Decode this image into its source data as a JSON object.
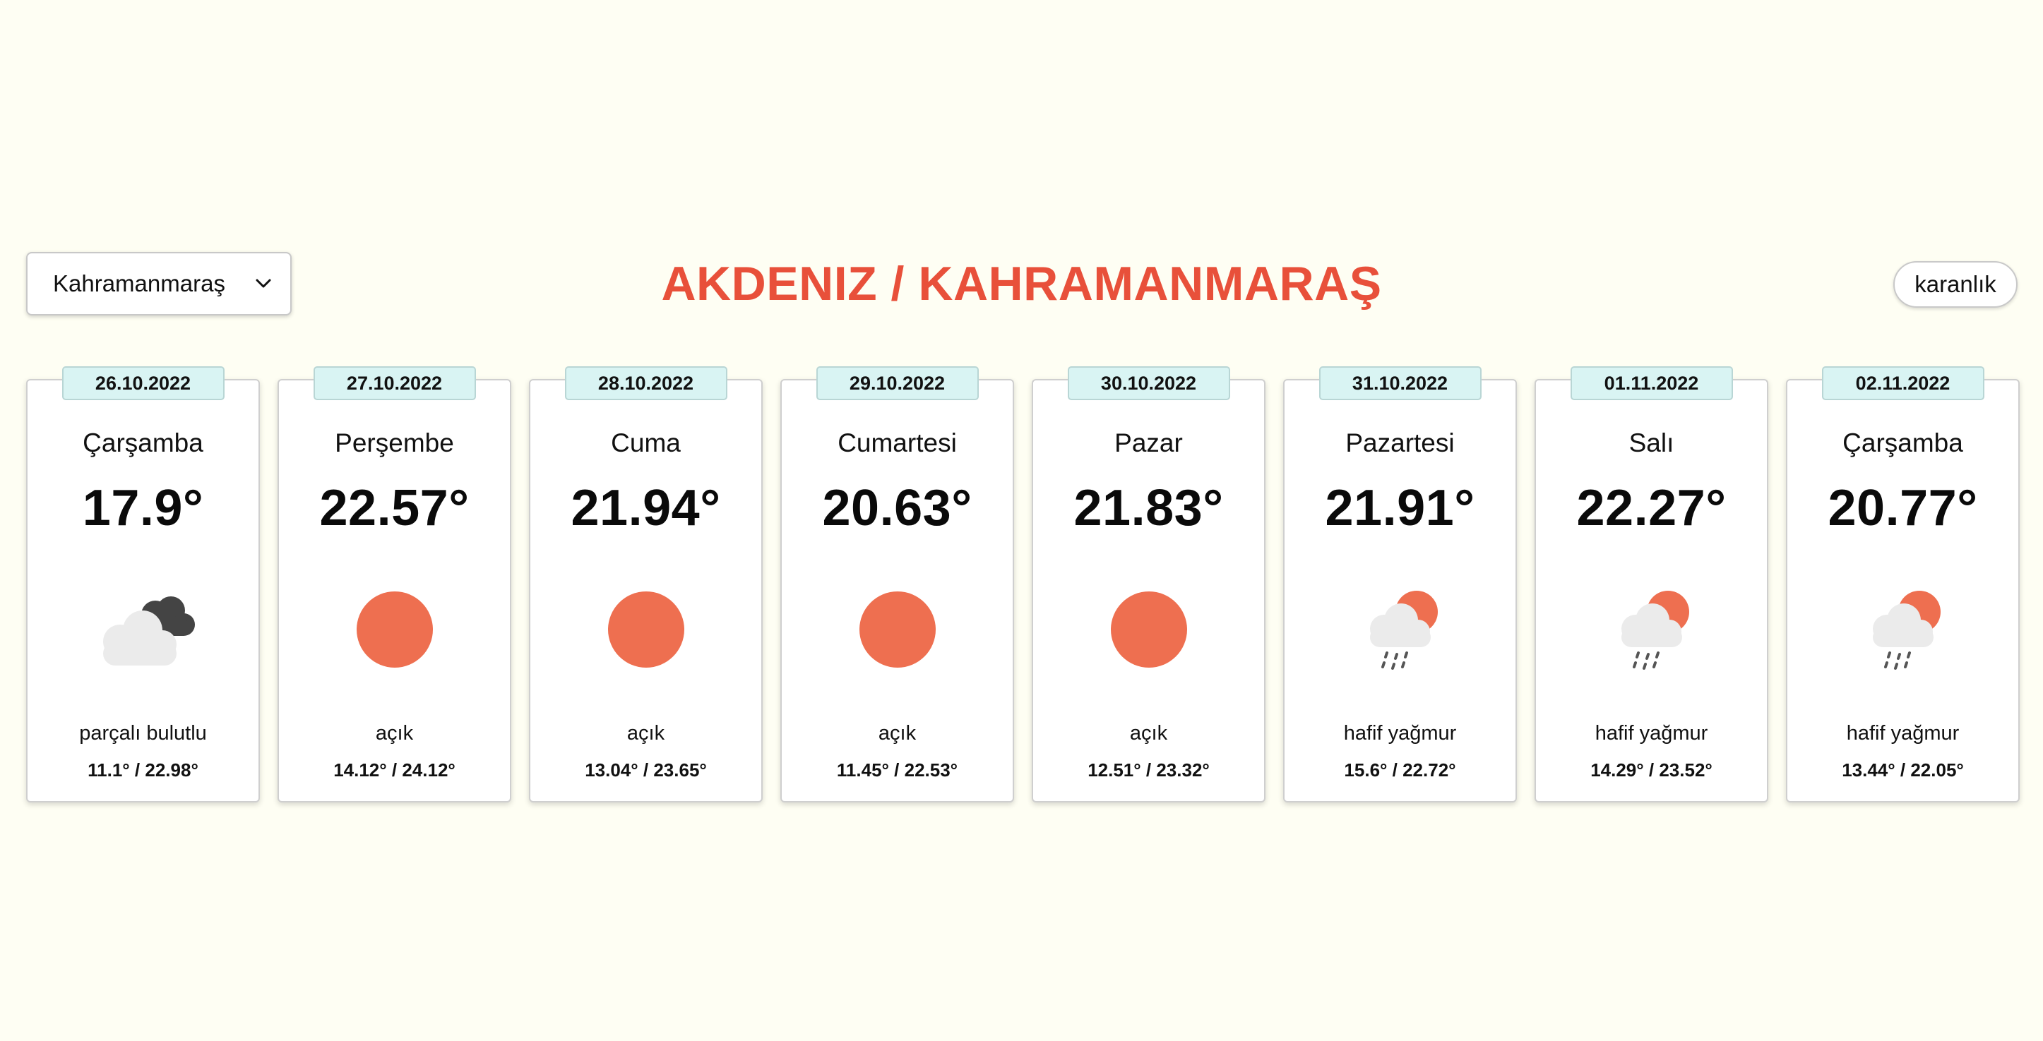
{
  "header": {
    "city_select": {
      "value": "Kahramanmaraş"
    },
    "title": "AKDENIZ / KAHRAMANMARAŞ",
    "theme_toggle_label": "karanlık"
  },
  "colors": {
    "title": "#e8503a",
    "sun": "#ee6f50",
    "badge_bg": "#d9f4f3",
    "page_bg": "#fefef3"
  },
  "forecast": [
    {
      "date": "26.10.2022",
      "day": "Çarşamba",
      "temp": "17.9°",
      "icon": "partly-cloudy-icon",
      "desc": "parçalı bulutlu",
      "minmax": "11.1° / 22.98°"
    },
    {
      "date": "27.10.2022",
      "day": "Perşembe",
      "temp": "22.57°",
      "icon": "sun-icon",
      "desc": "açık",
      "minmax": "14.12° / 24.12°"
    },
    {
      "date": "28.10.2022",
      "day": "Cuma",
      "temp": "21.94°",
      "icon": "sun-icon",
      "desc": "açık",
      "minmax": "13.04° / 23.65°"
    },
    {
      "date": "29.10.2022",
      "day": "Cumartesi",
      "temp": "20.63°",
      "icon": "sun-icon",
      "desc": "açık",
      "minmax": "11.45° / 22.53°"
    },
    {
      "date": "30.10.2022",
      "day": "Pazar",
      "temp": "21.83°",
      "icon": "sun-icon",
      "desc": "açık",
      "minmax": "12.51° / 23.32°"
    },
    {
      "date": "31.10.2022",
      "day": "Pazartesi",
      "temp": "21.91°",
      "icon": "light-rain-icon",
      "desc": "hafif yağmur",
      "minmax": "15.6° / 22.72°"
    },
    {
      "date": "01.11.2022",
      "day": "Salı",
      "temp": "22.27°",
      "icon": "light-rain-icon",
      "desc": "hafif yağmur",
      "minmax": "14.29° / 23.52°"
    },
    {
      "date": "02.11.2022",
      "day": "Çarşamba",
      "temp": "20.77°",
      "icon": "light-rain-icon",
      "desc": "hafif yağmur",
      "minmax": "13.44° / 22.05°"
    }
  ]
}
